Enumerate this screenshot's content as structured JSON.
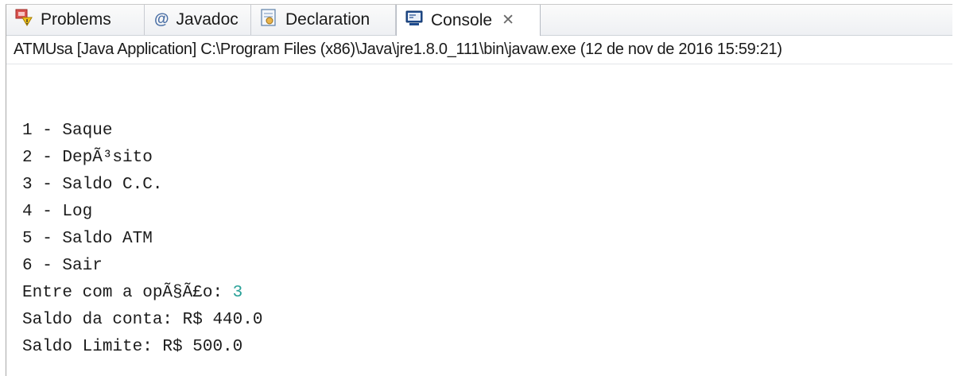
{
  "tabs": [
    {
      "label": "Problems",
      "icon": "problems-icon",
      "active": false
    },
    {
      "label": "Javadoc",
      "icon": "javadoc-icon",
      "active": false
    },
    {
      "label": "Declaration",
      "icon": "declaration-icon",
      "active": false
    },
    {
      "label": "Console",
      "icon": "console-icon",
      "active": true,
      "close_glyph": "✕"
    }
  ],
  "console": {
    "description": "ATMUsa [Java Application] C:\\Program Files (x86)\\Java\\jre1.8.0_111\\bin\\javaw.exe (12 de nov de 2016 15:59:21)",
    "lines": [
      "1 - Saque",
      "2 - DepÃ³sito",
      "3 - Saldo C.C.",
      "4 - Log",
      "5 - Saldo ATM",
      "6 - Sair"
    ],
    "prompt": "Entre com a opÃ§Ã£o: ",
    "user_input": "3",
    "result_lines": [
      "Saldo da conta: R$ 440.0",
      "Saldo Limite: R$ 500.0"
    ]
  },
  "colors": {
    "user_input": "#2aa198",
    "text": "#1c1c1c",
    "tab_border": "#c9ccd2"
  }
}
